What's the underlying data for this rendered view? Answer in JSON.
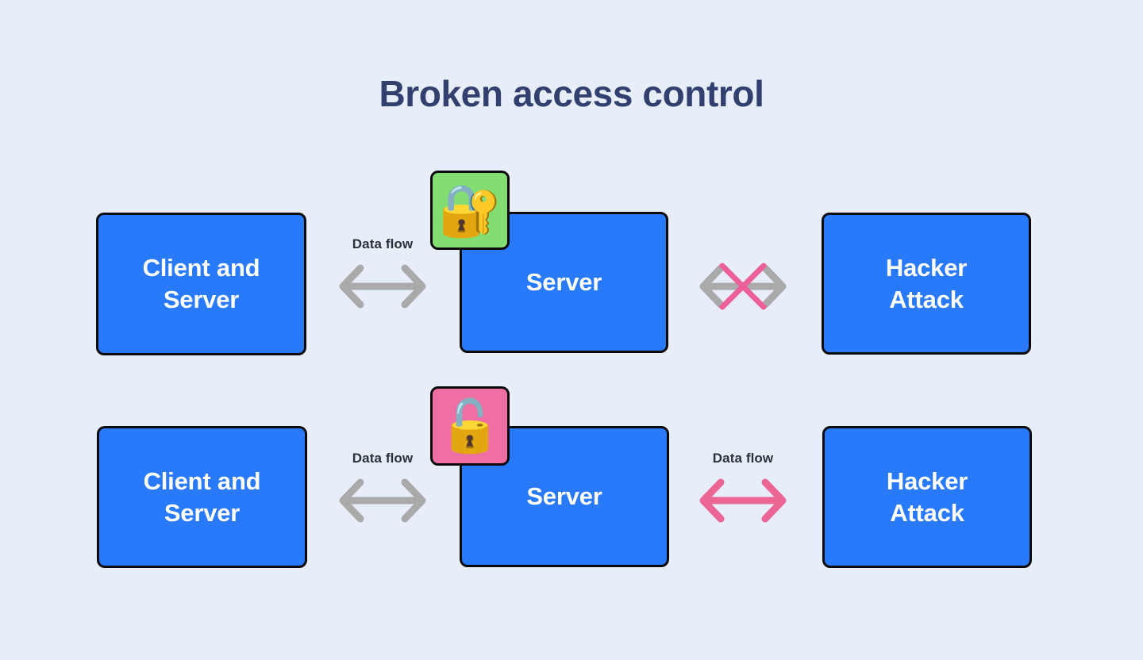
{
  "page": {
    "title": "Broken access control",
    "background_color": "#e7eefa"
  },
  "colors": {
    "node_fill": "#2979fb",
    "node_border": "#0a0a0a",
    "node_text": "#ffffff",
    "title_text": "#31406e",
    "badge_secure": "#82dd72",
    "badge_broken": "#ef6fa4",
    "arrow_gray": "#aaaaaa",
    "arrow_pink": "#ec6695",
    "block_x": "#ec5f97",
    "label_text": "#2c3038"
  },
  "rows": [
    {
      "name": "secure-row",
      "nodes": {
        "client": "Client and\nServer",
        "server": "Server",
        "hacker": "Hacker\nAttack"
      },
      "badge": {
        "icon": "closed-padlock-with-key-icon",
        "glyph": "🔐",
        "state": "locked",
        "color": "#82dd72"
      },
      "left_connector": {
        "label": "Data flow",
        "style": "bidirectional-gray-arrow",
        "blocked": false,
        "color": "#aaaaaa"
      },
      "right_connector": {
        "label": "",
        "style": "bidirectional-gray-arrow-blocked",
        "blocked": true,
        "color": "#aaaaaa",
        "block_color": "#ec5f97"
      }
    },
    {
      "name": "broken-row",
      "nodes": {
        "client": "Client and\nServer",
        "server": "Server",
        "hacker": "Hacker\nAttack"
      },
      "badge": {
        "icon": "open-padlock-icon",
        "glyph": "🔓",
        "state": "unlocked",
        "color": "#ef6fa4"
      },
      "left_connector": {
        "label": "Data flow",
        "style": "bidirectional-gray-arrow",
        "blocked": false,
        "color": "#aaaaaa"
      },
      "right_connector": {
        "label": "Data flow",
        "style": "bidirectional-pink-arrow",
        "blocked": false,
        "color": "#ec6695"
      }
    }
  ]
}
